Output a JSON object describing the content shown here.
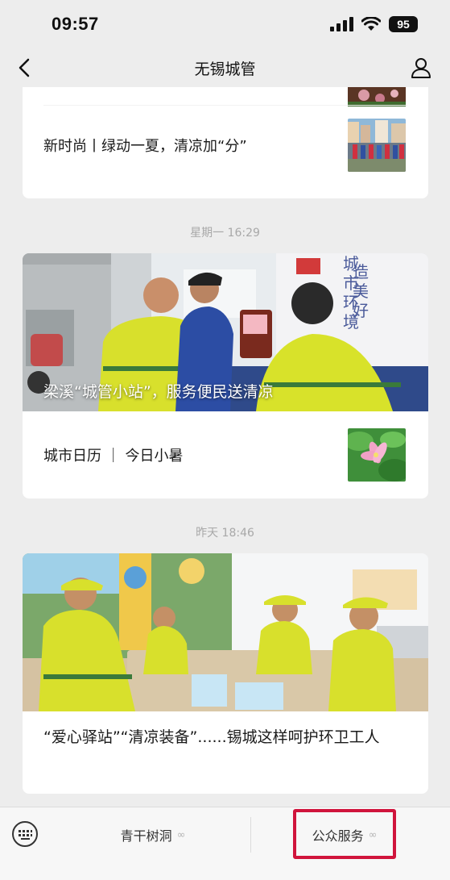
{
  "status_bar": {
    "time": "09:57",
    "battery": "95"
  },
  "nav": {
    "title": "无锡城管"
  },
  "feed": {
    "item1": {
      "text": "新时尚丨绿动一夏，清凉加“分”"
    },
    "timestamp1": "星期一 16:29",
    "item2": {
      "hero_caption": "梁溪“城管小站”，服务便民送清凉",
      "sub_text": "城市日历 ｜ 今日小暑"
    },
    "timestamp2": "昨天 18:46",
    "item3": {
      "title": "“爱心驿站”“清凉装备”......锡城这样呵护环卫工人"
    }
  },
  "bottom_menu": {
    "item1": "青干树洞",
    "item2": "公众服务"
  },
  "colors": {
    "highlight": "#d0143c",
    "background": "#ededed"
  }
}
